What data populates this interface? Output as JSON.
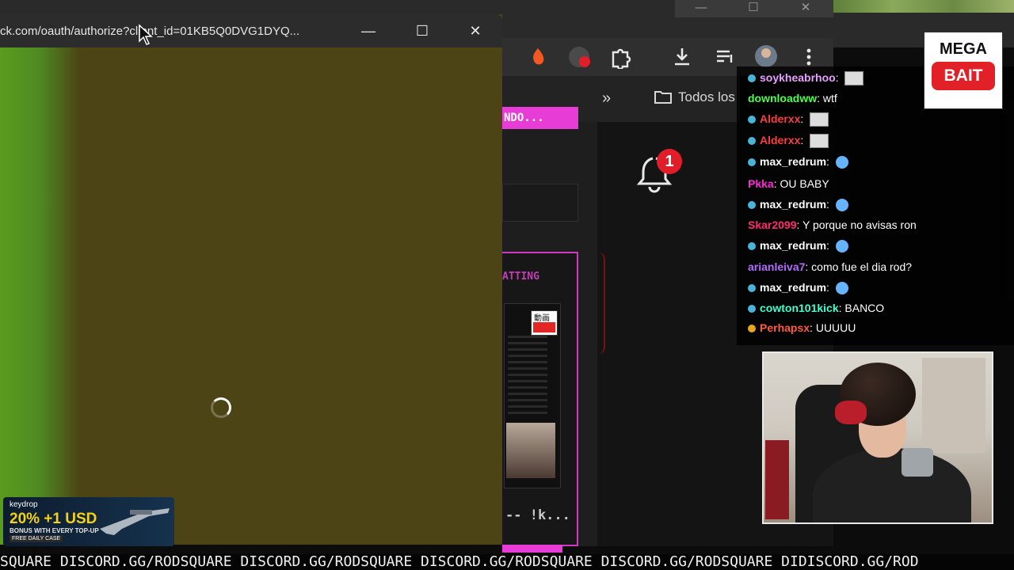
{
  "popup": {
    "url": "ck.com/oauth/authorize?client_id=01KB5Q0DVG1DYQ...",
    "minimize_glyph": "—",
    "maximize_glyph": "☐",
    "close_glyph": "✕"
  },
  "background_browser": {
    "overflow_glyph": "»",
    "bookmark_folder_label": "Todos los",
    "pink_banner_text": "NDO...",
    "chatting_label": "ATTING",
    "footer_text": "-- !k...",
    "notification_count": "1",
    "preview_tag": "動画"
  },
  "chat": {
    "messages": [
      {
        "user": "soykheabrhoo",
        "text": "",
        "color": "#e7a0ff",
        "emote": true
      },
      {
        "user": "downloadww",
        "text": "wtf",
        "color": "#4dff4d",
        "badge": false
      },
      {
        "user": "Alderxx",
        "text": "",
        "color": "#ff3b3b",
        "emote": true
      },
      {
        "user": "Alderxx",
        "text": "",
        "color": "#ff3b3b",
        "emote": true
      },
      {
        "user": "max_redrum",
        "text": "",
        "color": "#ffffff",
        "face": true
      },
      {
        "user": "Pkka",
        "text": "OU BABY",
        "color": "#ff2bd6",
        "badge": false
      },
      {
        "user": "max_redrum",
        "text": "",
        "color": "#ffffff",
        "face": true
      },
      {
        "user": "Skar2099",
        "text": "Y porque no avisas ron",
        "color": "#ff2b6e",
        "badge": false
      },
      {
        "user": "max_redrum",
        "text": "",
        "color": "#ffffff",
        "face": true
      },
      {
        "user": "arianleiva7",
        "text": "como fue el dia rod?",
        "color": "#b26bff",
        "badge": false
      },
      {
        "user": "max_redrum",
        "text": "",
        "color": "#ffffff",
        "face": true
      },
      {
        "user": "cowton101kick",
        "text": "BANCO",
        "color": "#3dffd0",
        "badge": true
      },
      {
        "user": "Perhapsx",
        "text": "UUUUU",
        "color": "#ff5a3d",
        "badge": "gold"
      }
    ]
  },
  "badge": {
    "top": "MEGA",
    "button": "BAIT"
  },
  "ad": {
    "brand": "keydrop",
    "main": "20% +1 USD",
    "sub": "BONUS WITH EVERY TOP-UP",
    "free": "FREE DAILY CASE"
  },
  "ticker": "SQUARE DISCORD.GG/RODSQUARE DISCORD.GG/RODSQUARE DISCORD.GG/RODSQUARE DISCORD.GG/RODSQUARE DIDISCORD.GG/ROD",
  "colors": {
    "popup_bg": "#4c4415",
    "accent_pink": "#e73cd6",
    "notification_red": "#e11d2a"
  }
}
